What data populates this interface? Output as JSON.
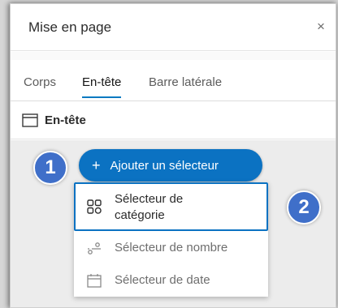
{
  "panel": {
    "title": "Mise en page",
    "close_glyph": "×"
  },
  "tabs": [
    {
      "label": "Corps",
      "active": false
    },
    {
      "label": "En-tête",
      "active": true
    },
    {
      "label": "Barre latérale",
      "active": false
    }
  ],
  "section": {
    "label": "En-tête",
    "icon": "header-layout-icon"
  },
  "add_button": {
    "plus": "+",
    "label": "Ajouter un sélecteur"
  },
  "dropdown": {
    "items": [
      {
        "line1": "Sélecteur de",
        "line2": "catégorie",
        "icon": "category-grid-icon",
        "highlighted": true
      },
      {
        "label": "Sélecteur de nombre",
        "icon": "number-slider-icon"
      },
      {
        "label": "Sélecteur de date",
        "icon": "calendar-icon"
      }
    ]
  },
  "callouts": {
    "one": "1",
    "two": "2"
  },
  "colors": {
    "accent": "#0b72c2",
    "badge": "#3f6fc9"
  }
}
